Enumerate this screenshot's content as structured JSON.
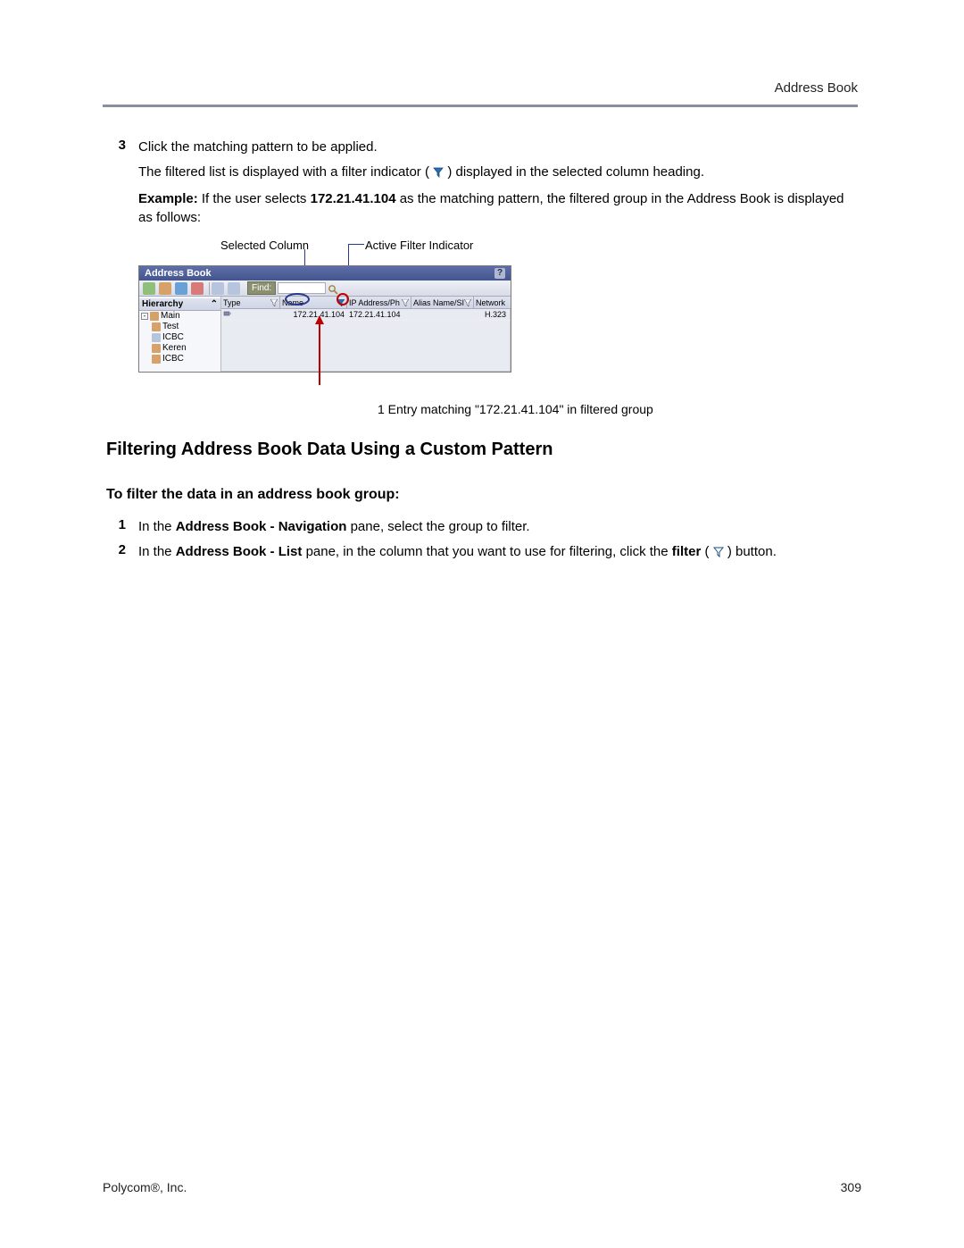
{
  "header": {
    "title": "Address Book"
  },
  "steps_top": {
    "num3": "3",
    "line1": "Click the matching pattern to be applied.",
    "line2_a": "The filtered list is displayed with a filter indicator (",
    "line2_b": ") displayed in the selected column heading.",
    "example_bold": "Example:",
    "example_mid_a": " If the user selects ",
    "example_ip": "172.21.41.104",
    "example_mid_b": " as the matching pattern, the filtered group in the Address Book is displayed as follows:"
  },
  "callouts": {
    "selected_column": "Selected Column",
    "active_filter": "Active Filter Indicator"
  },
  "abook": {
    "title": "Address Book",
    "find": "Find:",
    "hierarchy": "Hierarchy",
    "pin": "⌃",
    "tree": [
      "Main",
      "Test",
      "ICBC",
      "Keren",
      "ICBC"
    ],
    "columns": {
      "type": "Type",
      "name": "Name",
      "ip": "IP Address/Ph",
      "alias": "Alias Name/SI",
      "network": "Network"
    },
    "row": {
      "name": "172.21.41.104",
      "ip": "172.21.41.104",
      "network": "H.323"
    },
    "caption": "1 Entry matching \"172.21.41.104\" in filtered group"
  },
  "h2": "Filtering Address Book Data Using a Custom Pattern",
  "h3": "To filter the data in an address book group:",
  "steps_bottom": {
    "num1": "1",
    "s1_a": "In the ",
    "s1_b": "Address Book - Navigation",
    "s1_c": " pane, select the group to filter.",
    "num2": "2",
    "s2_a": "In the ",
    "s2_b": "Address Book - List",
    "s2_c": " pane, in the column that you want to use for filtering, click the ",
    "s2_d": "filter",
    "s2_e": " (",
    "s2_f": ") button."
  },
  "footer": {
    "company": "Polycom®, Inc.",
    "page": "309"
  }
}
